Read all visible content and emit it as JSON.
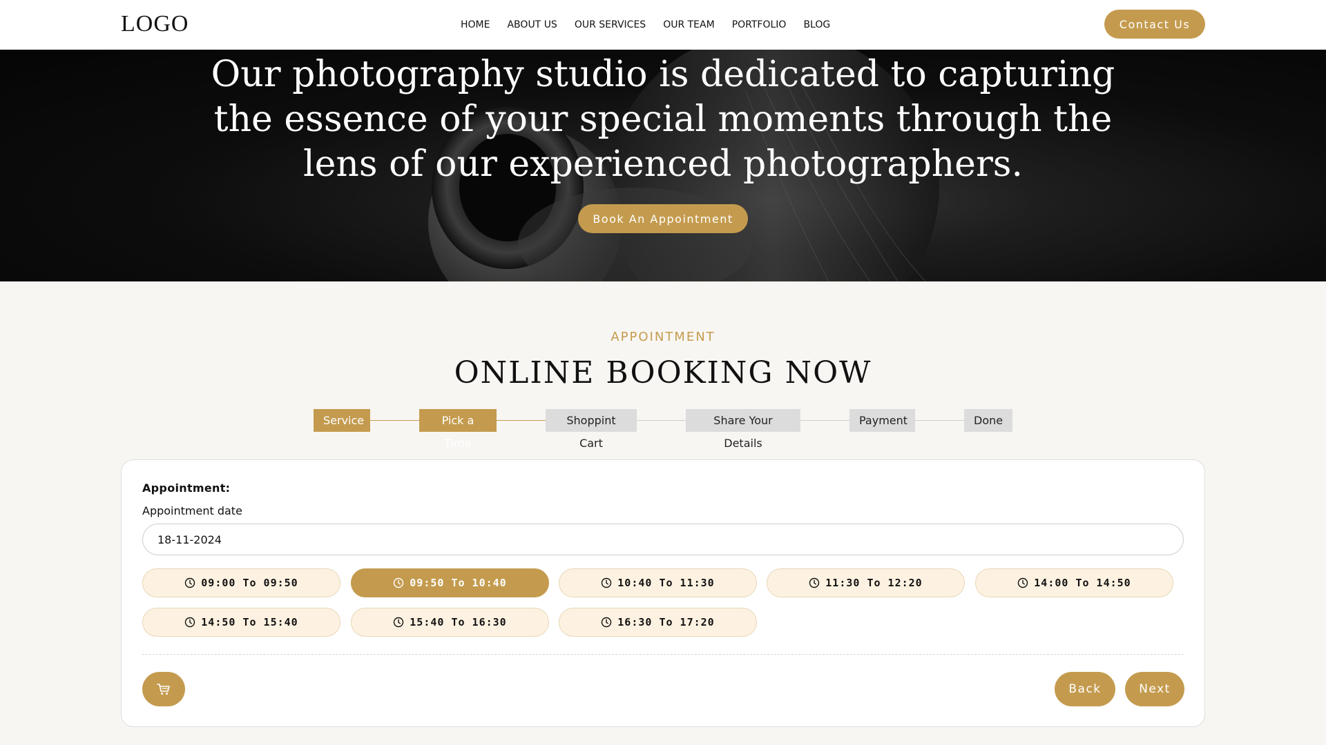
{
  "header": {
    "logo": "LOGO",
    "nav": [
      "HOME",
      "ABOUT US",
      "OUR SERVICES",
      "OUR TEAM",
      "PORTFOLIO",
      "BLOG"
    ],
    "contact_label": "Contact Us"
  },
  "hero": {
    "title": "Our photography studio is dedicated to capturing the essence of your special moments through the lens of our experienced photographers.",
    "cta_label": "Book An Appointment"
  },
  "section": {
    "eyebrow": "APPOINTMENT",
    "title": "ONLINE BOOKING NOW"
  },
  "steps": [
    {
      "label": "Service",
      "active": true
    },
    {
      "label": "Pick a Time",
      "active": true
    },
    {
      "label": "Shoppint Cart",
      "active": false
    },
    {
      "label": "Share Your Details",
      "active": false
    },
    {
      "label": "Payment",
      "active": false
    },
    {
      "label": "Done",
      "active": false
    }
  ],
  "booking": {
    "appointment_label": "Appointment:",
    "date_label": "Appointment date",
    "date_value": "18-11-2024",
    "slots": [
      {
        "label": "09:00 To 09:50",
        "selected": false
      },
      {
        "label": "09:50 To 10:40",
        "selected": true
      },
      {
        "label": "10:40 To 11:30",
        "selected": false
      },
      {
        "label": "11:30 To 12:20",
        "selected": false
      },
      {
        "label": "14:00 To 14:50",
        "selected": false
      },
      {
        "label": "14:50 To 15:40",
        "selected": false
      },
      {
        "label": "15:40 To 16:30",
        "selected": false
      },
      {
        "label": "16:30 To 17:20",
        "selected": false
      }
    ],
    "cart_icon": "cart-icon",
    "back_label": "Back",
    "next_label": "Next"
  },
  "colors": {
    "accent": "#c49b4e",
    "slot_bg": "#fdf2e1",
    "step_inactive": "#dcdcdc"
  }
}
